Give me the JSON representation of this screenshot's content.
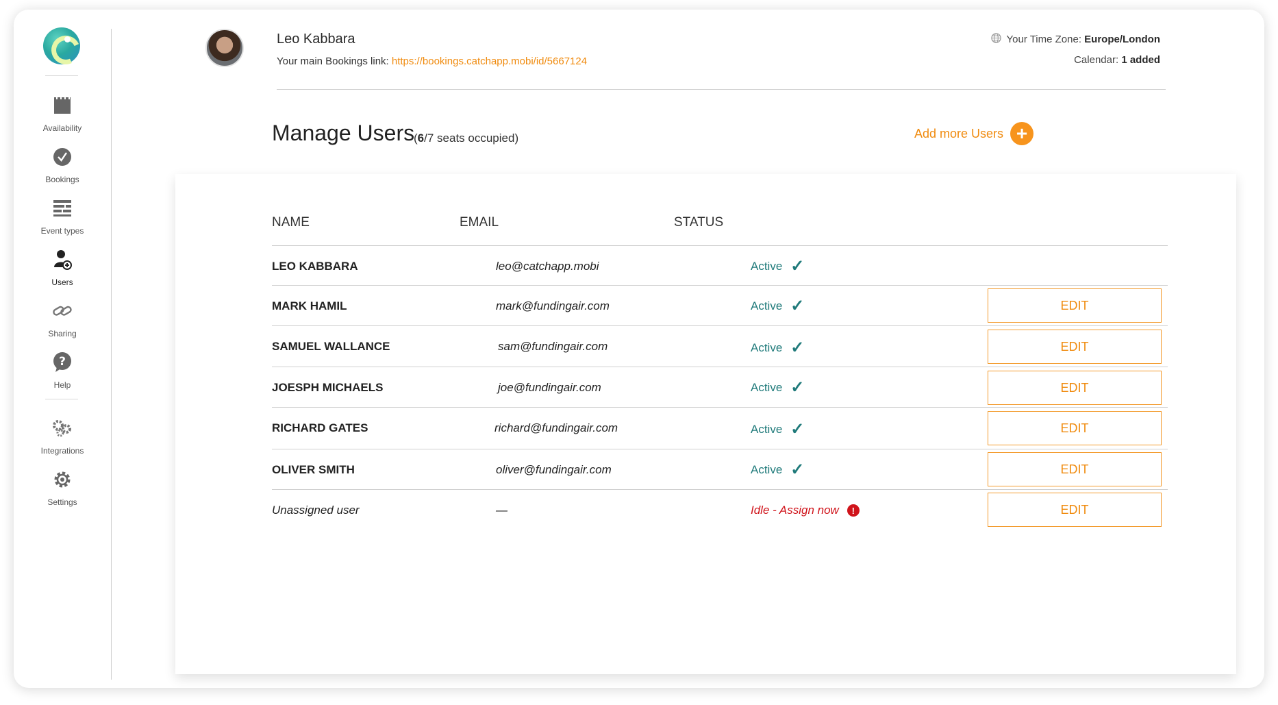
{
  "sidebar": {
    "items": [
      {
        "label": "Availability",
        "icon": "calendar-icon"
      },
      {
        "label": "Bookings",
        "icon": "check-circle-icon"
      },
      {
        "label": "Event types",
        "icon": "list-icon"
      },
      {
        "label": "Users",
        "icon": "user-add-icon"
      },
      {
        "label": "Sharing",
        "icon": "link-icon"
      },
      {
        "label": "Help",
        "icon": "help-bubble-icon"
      },
      {
        "label": "Integrations",
        "icon": "gears-icon"
      },
      {
        "label": "Settings",
        "icon": "gear-icon"
      }
    ],
    "active": "Users"
  },
  "header": {
    "name": "Leo Kabbara",
    "bookings_label": "Your main Bookings link: ",
    "bookings_url": "https://bookings.catchapp.mobi/id/5667124",
    "timezone_label": "Your Time Zone: ",
    "timezone_value": "Europe/London",
    "calendar_label": "Calendar: ",
    "calendar_value": "1 added"
  },
  "page": {
    "title": "Manage Users",
    "seats_open": " (",
    "seats_count": "6",
    "seats_rest": "/7 seats occupied)",
    "add_more_label": "Add more Users"
  },
  "table": {
    "columns": [
      "NAME",
      "EMAIL",
      "STATUS"
    ],
    "edit_label": "EDIT",
    "rows": [
      {
        "name": "LEO KABBARA",
        "email": "leo@catchapp.mobi",
        "status": "Active",
        "editable": false
      },
      {
        "name": "MARK HAMIL",
        "email": "mark@fundingair.com",
        "status": "Active",
        "editable": true
      },
      {
        "name": "SAMUEL WALLANCE",
        "email": "sam@fundingair.com",
        "status": "Active",
        "editable": true
      },
      {
        "name": "JOESPH MICHAELS",
        "email": "joe@fundingair.com",
        "status": "Active",
        "editable": true
      },
      {
        "name": "RICHARD GATES",
        "email": "richard@fundingair.com",
        "status": "Active",
        "editable": true
      },
      {
        "name": "OLIVER SMITH",
        "email": "oliver@fundingair.com",
        "status": "Active",
        "editable": true
      },
      {
        "name": "Unassigned user",
        "email": "—",
        "status": "Idle - Assign now",
        "editable": true
      }
    ]
  },
  "colors": {
    "accent": "#f08b0f",
    "active_status": "#1f7a7a",
    "idle_status": "#d0141b"
  }
}
